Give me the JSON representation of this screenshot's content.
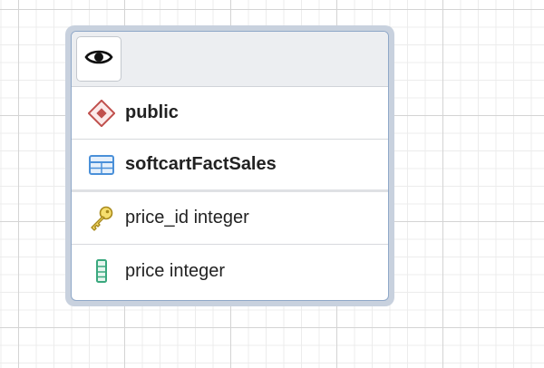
{
  "node": {
    "header": {
      "toggle_icon": "eye-icon"
    },
    "rows": [
      {
        "icon": "schema-icon",
        "label": "public"
      },
      {
        "icon": "table-icon",
        "label": "softcartFactSales"
      },
      {
        "icon": "primary-key-icon",
        "label": "price_id integer"
      },
      {
        "icon": "column-icon",
        "label": "price integer"
      }
    ]
  },
  "colors": {
    "schema_icon": "#c0504d",
    "table_icon": "#4a90d9",
    "key_icon": "#e8c94a",
    "column_icon": "#3aa87e",
    "selection_outline": "#c8d1de"
  }
}
